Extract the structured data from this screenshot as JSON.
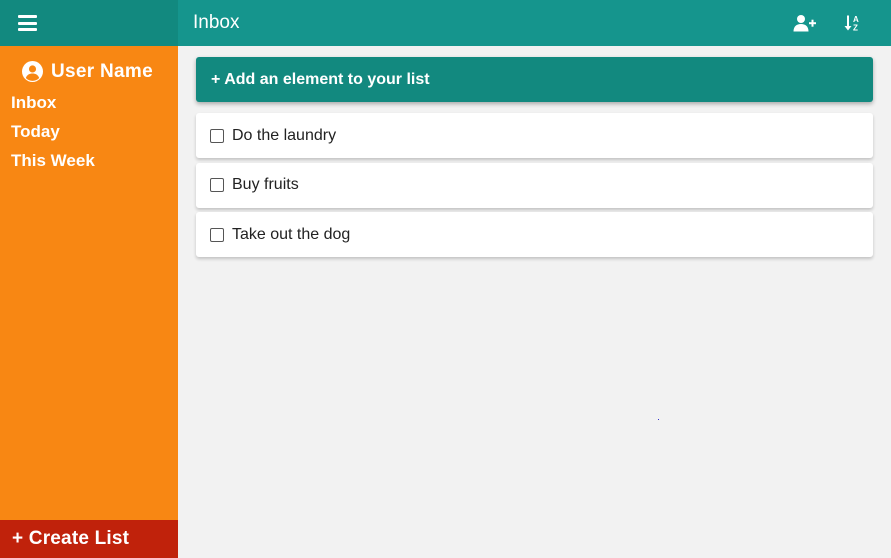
{
  "colors": {
    "sidebar_bg": "#f88713",
    "header_bg": "#15958d",
    "sidebar_header_bg": "#12897f",
    "create_list_bg": "#c0220b",
    "main_bg": "#f2f2f2"
  },
  "sidebar": {
    "menu_icon": "hamburger-icon",
    "user_icon": "user-circle-icon",
    "user_name": "User Name",
    "items": [
      {
        "label": "Inbox"
      },
      {
        "label": "Today"
      },
      {
        "label": "This Week"
      }
    ],
    "create_list_label": "+ Create List"
  },
  "header": {
    "title": "Inbox",
    "add_user_icon": "user-plus-icon",
    "sort_icon": "sort-alpha-icon"
  },
  "main": {
    "add_label": "+ Add an element to your list",
    "todos": [
      {
        "text": "Do the laundry",
        "checked": false
      },
      {
        "text": "Buy fruits",
        "checked": false
      },
      {
        "text": "Take out the dog",
        "checked": false
      }
    ]
  }
}
